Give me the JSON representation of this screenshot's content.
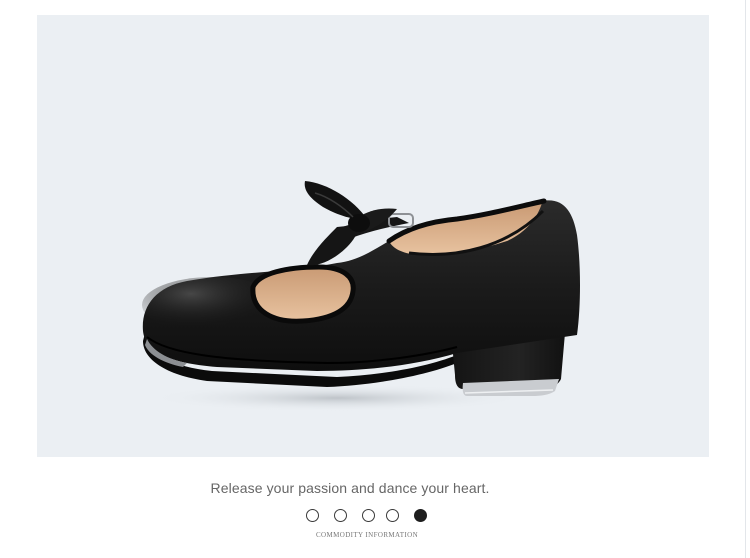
{
  "product": {
    "image_alt": "black tap shoe with bow"
  },
  "tagline": "Release your passion and dance your heart.",
  "carousel": {
    "dots": [
      {
        "active": false
      },
      {
        "active": false
      },
      {
        "active": false
      },
      {
        "active": false
      },
      {
        "active": true
      }
    ],
    "caption": "COMMODITY INFORMATION"
  },
  "colors": {
    "panel_background": "#ebeff3",
    "shoe": "#1c1c1c",
    "lining": "#e0b48e",
    "tap_plate": "#c9ccd0",
    "text": "#666666"
  }
}
